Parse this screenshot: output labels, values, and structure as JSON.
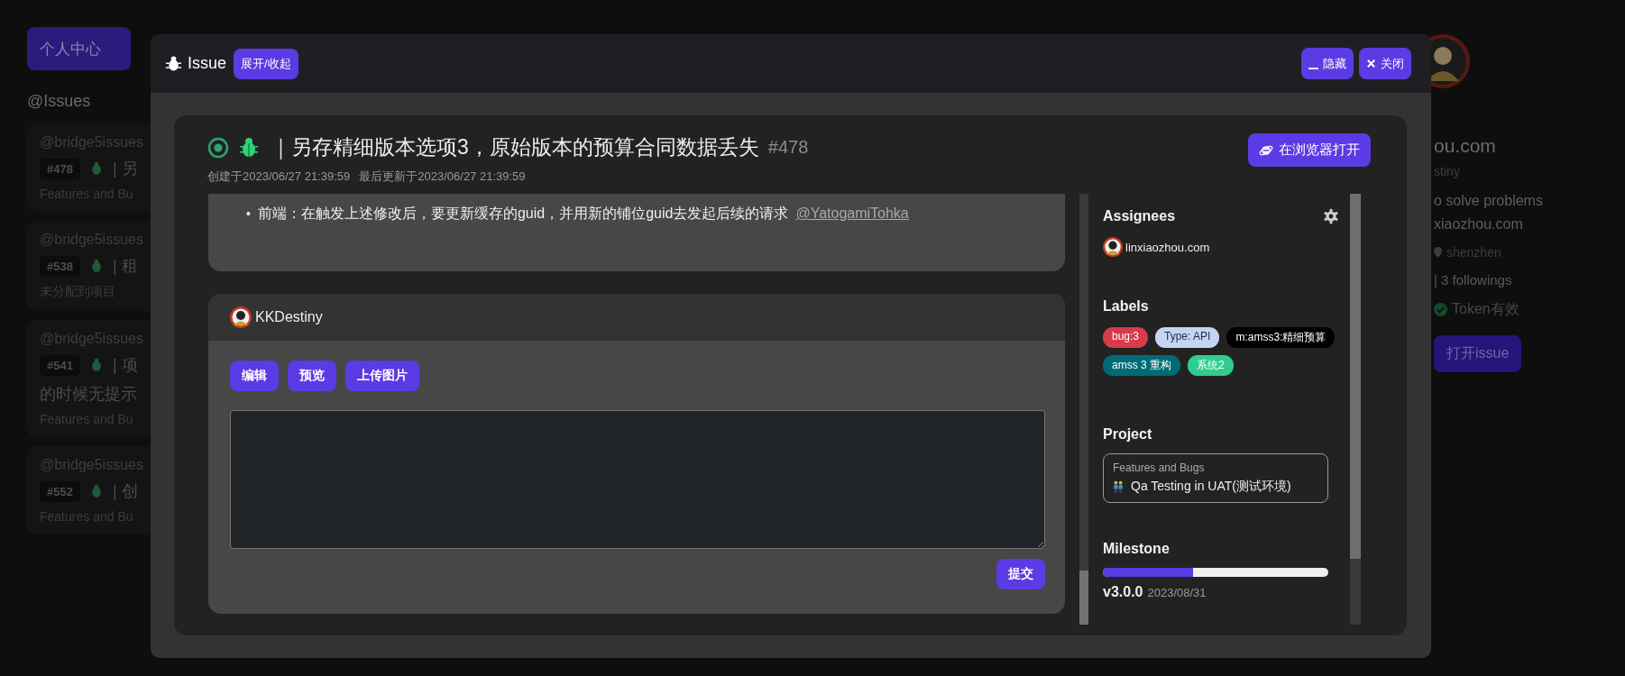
{
  "background": {
    "home_button": "个人中心",
    "issues_heading": "@Issues",
    "issue_cards": [
      {
        "repo": "@bridge5issues",
        "number": "#478",
        "title_lines": [
          "| 另"
        ],
        "project": "Features and Bu"
      },
      {
        "repo": "@bridge5issues",
        "number": "#538",
        "title_lines": [
          "| 租"
        ],
        "project": "未分配到项目"
      },
      {
        "repo": "@bridge5issues",
        "number": "#541",
        "title_lines": [
          "| 项",
          "的时候无提示"
        ],
        "project": "Features and Bu"
      },
      {
        "repo": "@bridge5issues",
        "number": "#552",
        "title_lines": [
          "| 创"
        ],
        "project": "Features and Bu"
      }
    ],
    "profile": {
      "name": "ou.com",
      "username": "stiny",
      "bio": "o solve problems",
      "website": "xiaozhou.com",
      "location": "shenzhen",
      "follows": "| 3 followings",
      "token_status": "Token有效",
      "open_button": "打开issue"
    }
  },
  "dialog": {
    "title": "Issue",
    "toggle_button": "展开/收起",
    "hide_button": "隐藏",
    "close_button": "关闭"
  },
  "issue": {
    "open": true,
    "title": "｜另存精细版本选项3，原始版本的预算合同数据丢失",
    "number": "#478",
    "created": "创建于2023/06/27 21:39:59",
    "updated": "最后更新于2023/06/27 21:39:59",
    "open_button": "在浏览器打开",
    "body_items": [
      {
        "marker": "•",
        "text": "前端：在触发上述修改后，要更新缓存的guid，并用新的铺位guid去发起后续的请求",
        "mention": "@YatogamiTohka"
      }
    ]
  },
  "comment": {
    "user": "KKDestiny",
    "buttons": [
      "编辑",
      "预览",
      "上传图片"
    ],
    "submit_button": "提交"
  },
  "sidebar": {
    "assignees": {
      "heading": "Assignees",
      "users": [
        "linxiaozhou.com"
      ]
    },
    "labels": {
      "heading": "Labels",
      "items": [
        {
          "text": "bug:3",
          "color": "#d73a4a"
        },
        {
          "text": "Type: API",
          "color": "#c5d4f0"
        },
        {
          "text": "m:amss3:精细预算",
          "color": "#000000"
        },
        {
          "text": "amss 3 重构",
          "color": "#006b75"
        },
        {
          "text": "系统2",
          "color": "#2ecc8e"
        }
      ]
    },
    "project": {
      "heading": "Project",
      "board": "Features and Bugs",
      "column": "Qa Testing in UAT(测试环境)"
    },
    "milestone": {
      "heading": "Milestone",
      "level": 0.4,
      "version": "v3.0.0",
      "due": "2023/08/31"
    }
  }
}
